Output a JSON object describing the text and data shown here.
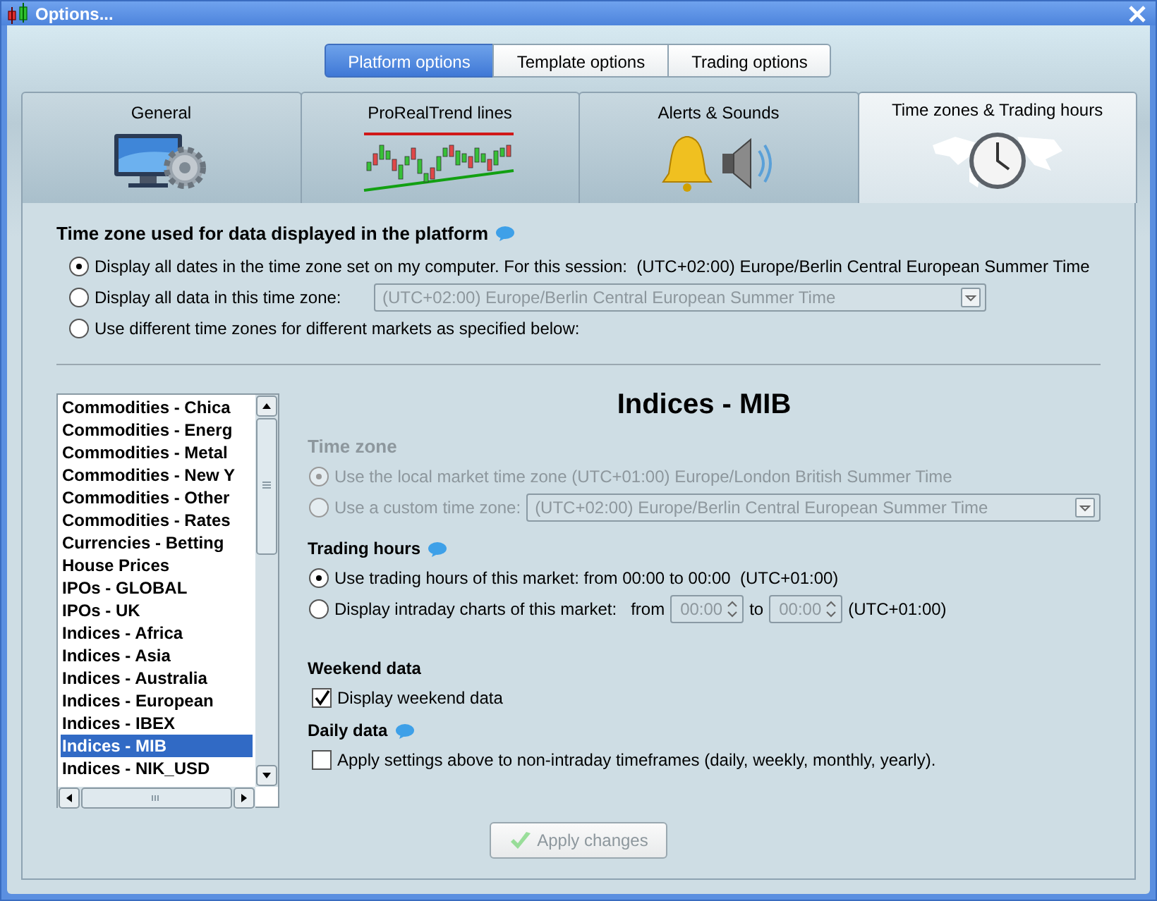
{
  "window": {
    "title": "Options..."
  },
  "option_tabs": [
    {
      "label": "Platform options",
      "selected": true
    },
    {
      "label": "Template options",
      "selected": false
    },
    {
      "label": "Trading options",
      "selected": false
    }
  ],
  "category_tabs": [
    {
      "label": "General",
      "selected": false,
      "kind": "general"
    },
    {
      "label": "ProRealTrend lines",
      "selected": false,
      "kind": "trendlines"
    },
    {
      "label": "Alerts & Sounds",
      "selected": false,
      "kind": "alerts"
    },
    {
      "label": "Time zones & Trading hours",
      "selected": true,
      "kind": "timezones"
    }
  ],
  "platform_time_zone": {
    "heading": "Time zone used for data displayed in the platform",
    "options": [
      {
        "label": "Display all dates in the time zone set on my computer. For this session:  (UTC+02:00) Europe/Berlin Central European Summer Time",
        "selected": true
      },
      {
        "label": "Display all data in this time zone:",
        "selected": false,
        "dropdown": {
          "value": "(UTC+02:00) Europe/Berlin Central European Summer Time",
          "disabled": true
        }
      },
      {
        "label": "Use different time zones for different markets as specified below:",
        "selected": false
      }
    ]
  },
  "markets": [
    {
      "label": "Commodities - Chica",
      "selected": false
    },
    {
      "label": "Commodities - Energ",
      "selected": false
    },
    {
      "label": "Commodities - Metal",
      "selected": false
    },
    {
      "label": "Commodities - New Y",
      "selected": false
    },
    {
      "label": "Commodities - Other",
      "selected": false
    },
    {
      "label": "Commodities - Rates",
      "selected": false
    },
    {
      "label": "Currencies - Betting",
      "selected": false
    },
    {
      "label": "House Prices",
      "selected": false
    },
    {
      "label": "IPOs - GLOBAL",
      "selected": false
    },
    {
      "label": "IPOs - UK",
      "selected": false
    },
    {
      "label": "Indices - Africa",
      "selected": false
    },
    {
      "label": "Indices - Asia",
      "selected": false
    },
    {
      "label": "Indices - Australia",
      "selected": false
    },
    {
      "label": "Indices - European",
      "selected": false
    },
    {
      "label": "Indices - IBEX",
      "selected": false
    },
    {
      "label": "Indices - MIB",
      "selected": true
    },
    {
      "label": "Indices - NIK_USD",
      "selected": false
    }
  ],
  "detail": {
    "title": "Indices - MIB",
    "time_zone": {
      "heading": "Time zone",
      "disabled": true,
      "options": [
        {
          "label": "Use the local market time zone (UTC+01:00) Europe/London British Summer Time",
          "selected": true
        },
        {
          "label": "Use a custom time zone:",
          "selected": false,
          "dropdown": {
            "value": "(UTC+02:00) Europe/Berlin Central European Summer Time",
            "disabled": true
          }
        }
      ]
    },
    "trading_hours": {
      "heading": "Trading hours",
      "options": [
        {
          "label": "Use trading hours of this market: from 00:00 to 00:00  (UTC+01:00)",
          "selected": true
        },
        {
          "label": "Display intraday charts of this market:",
          "selected": false,
          "range": {
            "from_label": "from",
            "from": "00:00",
            "to_label": "to",
            "to": "00:00",
            "zone": "(UTC+01:00)",
            "disabled": true
          }
        }
      ]
    },
    "weekend_data": {
      "heading": "Weekend data",
      "checkbox": {
        "label": "Display weekend data",
        "checked": true
      }
    },
    "daily_data": {
      "heading": "Daily data",
      "checkbox": {
        "label": "Apply settings above to non-intraday timeframes (daily, weekly, monthly, yearly).",
        "checked": false
      }
    }
  },
  "apply_button": {
    "label": "Apply changes",
    "disabled": true
  }
}
